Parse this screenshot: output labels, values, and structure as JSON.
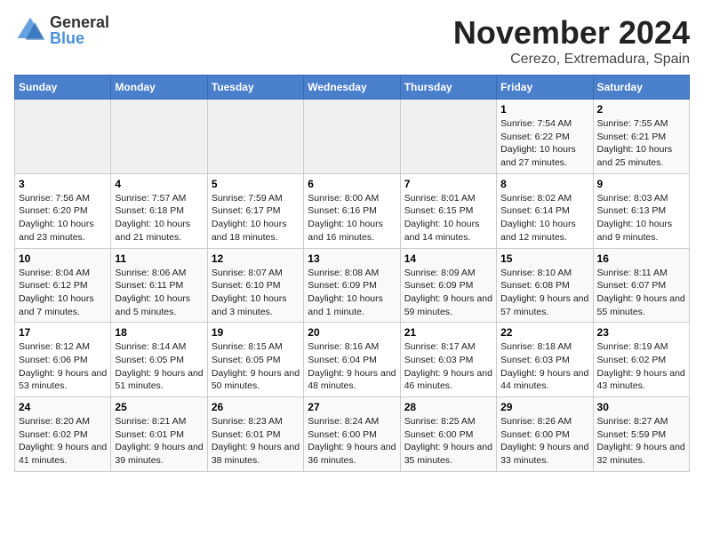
{
  "logo": {
    "line1": "General",
    "line2": "Blue"
  },
  "title": "November 2024",
  "subtitle": "Cerezo, Extremadura, Spain",
  "weekdays": [
    "Sunday",
    "Monday",
    "Tuesday",
    "Wednesday",
    "Thursday",
    "Friday",
    "Saturday"
  ],
  "weeks": [
    [
      {
        "day": "",
        "info": ""
      },
      {
        "day": "",
        "info": ""
      },
      {
        "day": "",
        "info": ""
      },
      {
        "day": "",
        "info": ""
      },
      {
        "day": "",
        "info": ""
      },
      {
        "day": "1",
        "info": "Sunrise: 7:54 AM\nSunset: 6:22 PM\nDaylight: 10 hours and 27 minutes."
      },
      {
        "day": "2",
        "info": "Sunrise: 7:55 AM\nSunset: 6:21 PM\nDaylight: 10 hours and 25 minutes."
      }
    ],
    [
      {
        "day": "3",
        "info": "Sunrise: 7:56 AM\nSunset: 6:20 PM\nDaylight: 10 hours and 23 minutes."
      },
      {
        "day": "4",
        "info": "Sunrise: 7:57 AM\nSunset: 6:18 PM\nDaylight: 10 hours and 21 minutes."
      },
      {
        "day": "5",
        "info": "Sunrise: 7:59 AM\nSunset: 6:17 PM\nDaylight: 10 hours and 18 minutes."
      },
      {
        "day": "6",
        "info": "Sunrise: 8:00 AM\nSunset: 6:16 PM\nDaylight: 10 hours and 16 minutes."
      },
      {
        "day": "7",
        "info": "Sunrise: 8:01 AM\nSunset: 6:15 PM\nDaylight: 10 hours and 14 minutes."
      },
      {
        "day": "8",
        "info": "Sunrise: 8:02 AM\nSunset: 6:14 PM\nDaylight: 10 hours and 12 minutes."
      },
      {
        "day": "9",
        "info": "Sunrise: 8:03 AM\nSunset: 6:13 PM\nDaylight: 10 hours and 9 minutes."
      }
    ],
    [
      {
        "day": "10",
        "info": "Sunrise: 8:04 AM\nSunset: 6:12 PM\nDaylight: 10 hours and 7 minutes."
      },
      {
        "day": "11",
        "info": "Sunrise: 8:06 AM\nSunset: 6:11 PM\nDaylight: 10 hours and 5 minutes."
      },
      {
        "day": "12",
        "info": "Sunrise: 8:07 AM\nSunset: 6:10 PM\nDaylight: 10 hours and 3 minutes."
      },
      {
        "day": "13",
        "info": "Sunrise: 8:08 AM\nSunset: 6:09 PM\nDaylight: 10 hours and 1 minute."
      },
      {
        "day": "14",
        "info": "Sunrise: 8:09 AM\nSunset: 6:09 PM\nDaylight: 9 hours and 59 minutes."
      },
      {
        "day": "15",
        "info": "Sunrise: 8:10 AM\nSunset: 6:08 PM\nDaylight: 9 hours and 57 minutes."
      },
      {
        "day": "16",
        "info": "Sunrise: 8:11 AM\nSunset: 6:07 PM\nDaylight: 9 hours and 55 minutes."
      }
    ],
    [
      {
        "day": "17",
        "info": "Sunrise: 8:12 AM\nSunset: 6:06 PM\nDaylight: 9 hours and 53 minutes."
      },
      {
        "day": "18",
        "info": "Sunrise: 8:14 AM\nSunset: 6:05 PM\nDaylight: 9 hours and 51 minutes."
      },
      {
        "day": "19",
        "info": "Sunrise: 8:15 AM\nSunset: 6:05 PM\nDaylight: 9 hours and 50 minutes."
      },
      {
        "day": "20",
        "info": "Sunrise: 8:16 AM\nSunset: 6:04 PM\nDaylight: 9 hours and 48 minutes."
      },
      {
        "day": "21",
        "info": "Sunrise: 8:17 AM\nSunset: 6:03 PM\nDaylight: 9 hours and 46 minutes."
      },
      {
        "day": "22",
        "info": "Sunrise: 8:18 AM\nSunset: 6:03 PM\nDaylight: 9 hours and 44 minutes."
      },
      {
        "day": "23",
        "info": "Sunrise: 8:19 AM\nSunset: 6:02 PM\nDaylight: 9 hours and 43 minutes."
      }
    ],
    [
      {
        "day": "24",
        "info": "Sunrise: 8:20 AM\nSunset: 6:02 PM\nDaylight: 9 hours and 41 minutes."
      },
      {
        "day": "25",
        "info": "Sunrise: 8:21 AM\nSunset: 6:01 PM\nDaylight: 9 hours and 39 minutes."
      },
      {
        "day": "26",
        "info": "Sunrise: 8:23 AM\nSunset: 6:01 PM\nDaylight: 9 hours and 38 minutes."
      },
      {
        "day": "27",
        "info": "Sunrise: 8:24 AM\nSunset: 6:00 PM\nDaylight: 9 hours and 36 minutes."
      },
      {
        "day": "28",
        "info": "Sunrise: 8:25 AM\nSunset: 6:00 PM\nDaylight: 9 hours and 35 minutes."
      },
      {
        "day": "29",
        "info": "Sunrise: 8:26 AM\nSunset: 6:00 PM\nDaylight: 9 hours and 33 minutes."
      },
      {
        "day": "30",
        "info": "Sunrise: 8:27 AM\nSunset: 5:59 PM\nDaylight: 9 hours and 32 minutes."
      }
    ]
  ]
}
